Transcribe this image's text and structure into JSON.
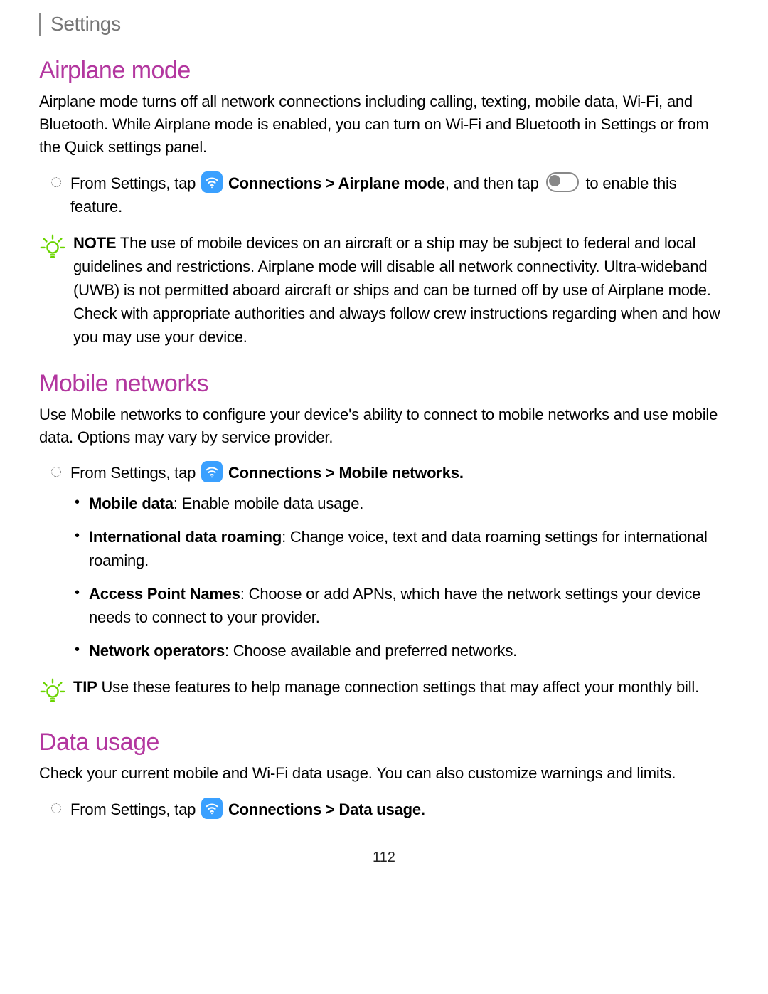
{
  "header": {
    "title": "Settings"
  },
  "sections": {
    "airplane": {
      "heading": "Airplane mode",
      "intro": "Airplane mode turns off all network connections including calling, texting, mobile data, Wi-Fi, and Bluetooth. While Airplane mode is enabled, you can turn on Wi-Fi and Bluetooth in Settings or from the Quick settings panel.",
      "step": {
        "pre": "From Settings, tap ",
        "conn_label": "Connections",
        "path_suffix": " > Airplane mode",
        "mid": ", and then tap ",
        "post": " to enable this feature."
      },
      "note_label": "NOTE",
      "note_body": "  The use of mobile devices on an aircraft or a ship may be subject to federal and local guidelines and restrictions. Airplane mode will disable all network connectivity. Ultra-wideband (UWB) is not permitted aboard aircraft or ships and can be turned off by use of Airplane mode. Check with appropriate authorities and always follow crew instructions regarding when and how you may use your device."
    },
    "mobile": {
      "heading": "Mobile networks",
      "intro": "Use Mobile networks to configure your device's ability to connect to mobile networks and use mobile data. Options may vary by service provider.",
      "step": {
        "pre": "From Settings, tap ",
        "conn_label": "Connections",
        "path_suffix": " > Mobile networks."
      },
      "items": [
        {
          "label": "Mobile data",
          "desc": ": Enable mobile data usage."
        },
        {
          "label": "International data roaming",
          "desc": ": Change voice, text and data roaming settings for international roaming."
        },
        {
          "label": "Access Point Names",
          "desc": ": Choose or add APNs, which have the network settings your device needs to connect to your provider."
        },
        {
          "label": "Network operators",
          "desc": ": Choose available and preferred networks."
        }
      ],
      "tip_label": "TIP",
      "tip_body": "  Use these features to help manage connection settings that may affect your monthly bill."
    },
    "data": {
      "heading": "Data usage",
      "intro": "Check your current mobile and Wi-Fi data usage. You can also customize warnings and limits.",
      "step": {
        "pre": "From Settings, tap ",
        "conn_label": "Connections",
        "path_suffix": " > Data usage."
      }
    }
  },
  "page_number": "112"
}
